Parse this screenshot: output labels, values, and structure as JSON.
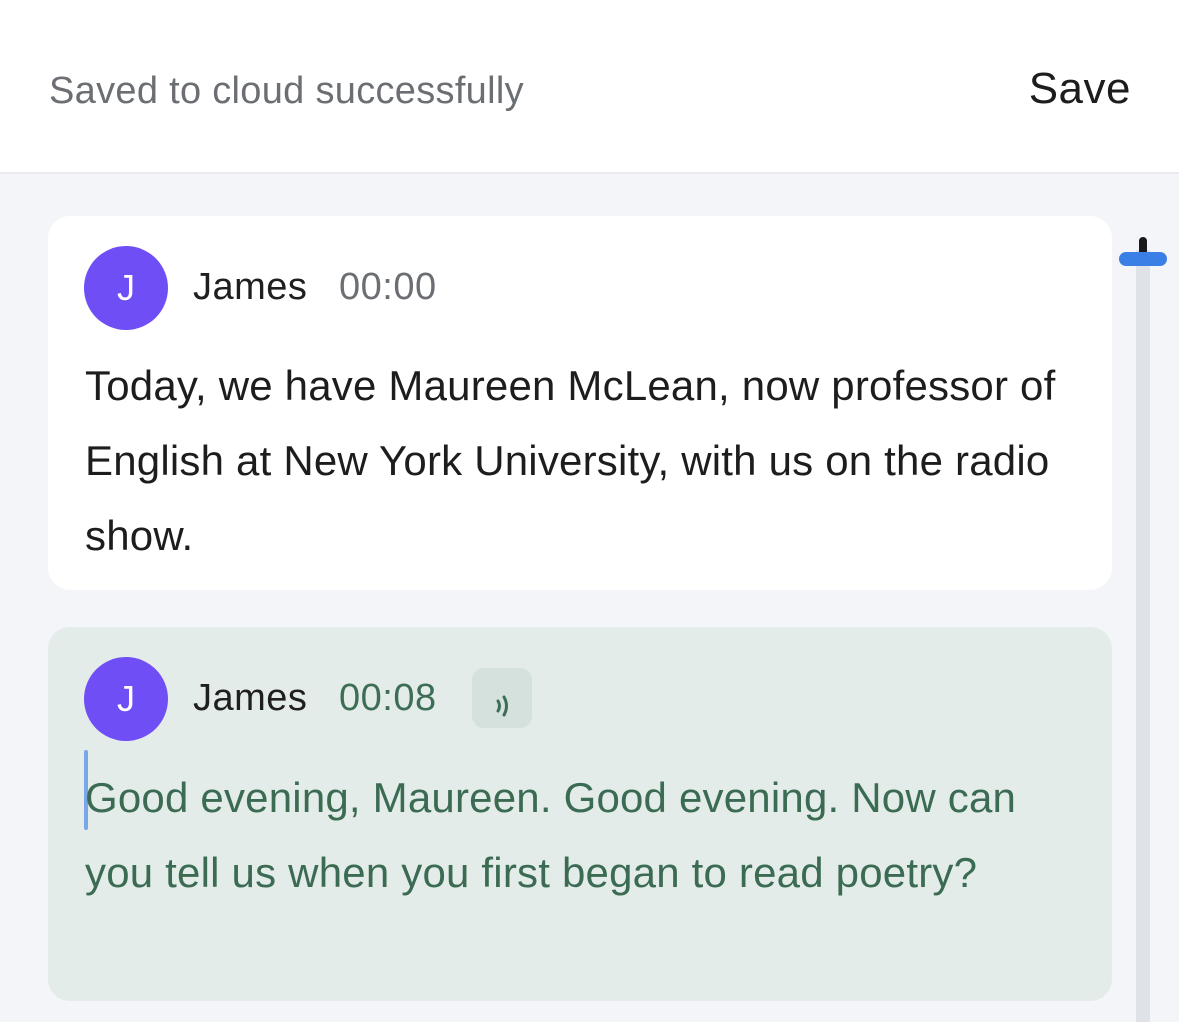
{
  "header": {
    "status_text": "Saved to cloud successfully",
    "save_label": "Save"
  },
  "transcript": [
    {
      "avatar_initial": "J",
      "speaker": "James",
      "time": "00:00",
      "text": "Today, we have Maureen McLean, now professor of English at New York University, with us on the radio show."
    },
    {
      "avatar_initial": "J",
      "speaker": "James",
      "time": "00:08",
      "text": "Good evening, Maureen. Good evening. Now can you tell us when you first began to read poetry?",
      "active": true,
      "playing_icon": "sound-wave-icon"
    }
  ],
  "colors": {
    "avatar": "#6f4ef6",
    "active_text": "#3b6b52",
    "active_bg": "#e3ece9",
    "scroll_accent": "#3a7fe6"
  }
}
